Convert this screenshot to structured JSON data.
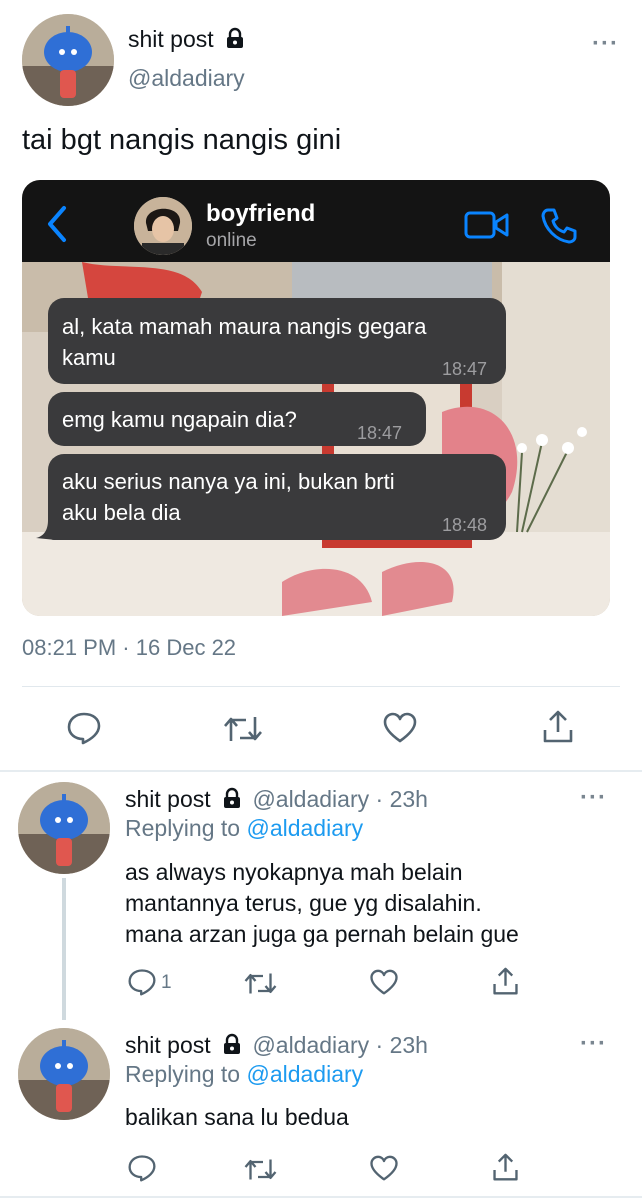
{
  "main_tweet": {
    "display_name": "shit post",
    "handle": "@aldadiary",
    "text": "tai bgt nangis nangis gini",
    "timestamp": "08:21 PM",
    "separator": "·",
    "date": "16 Dec 22",
    "more": "···"
  },
  "chat_screenshot": {
    "back_icon": "chevron-left-icon",
    "contact_name": "boyfriend",
    "status": "online",
    "messages": [
      {
        "line1": "al, kata mamah maura nangis gegara",
        "line2": "kamu",
        "time": "18:47"
      },
      {
        "line1": "emg kamu ngapain dia?",
        "line2": "",
        "time": "18:47"
      },
      {
        "line1": "aku serius nanya ya ini, bukan brti",
        "line2": "aku bela dia",
        "time": "18:48"
      }
    ],
    "colors": {
      "header": "#141414",
      "bubble": "#3a3a3c",
      "accent": "#0a84ff"
    }
  },
  "replies": [
    {
      "display_name": "shit post",
      "handle": "@aldadiary",
      "time": "· 23h",
      "replying_prefix": "Replying to",
      "replying_to": "@aldadiary",
      "lines": [
        "as always nyokapnya mah belain",
        "mantannya terus, gue yg disalahin.",
        "mana arzan juga ga pernah belain gue"
      ],
      "reply_count": "1",
      "more": "···"
    },
    {
      "display_name": "shit post",
      "handle": "@aldadiary",
      "time": "· 23h",
      "replying_prefix": "Replying to",
      "replying_to": "@aldadiary",
      "lines": [
        "balikan sana lu bedua"
      ],
      "reply_count": "",
      "more": "···"
    }
  ],
  "icons": [
    "lock-icon",
    "reply-icon",
    "retweet-icon",
    "like-icon",
    "share-icon",
    "video-call-icon",
    "phone-icon"
  ],
  "colors": {
    "link": "#1d9bf0",
    "muted": "#657786",
    "divider": "#e1e8ed"
  }
}
